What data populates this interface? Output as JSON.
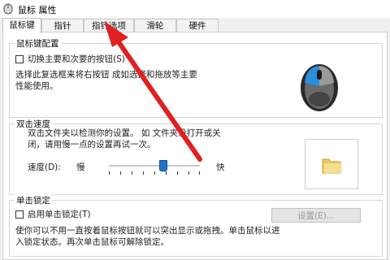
{
  "window": {
    "title": "鼠标 属性"
  },
  "tabs": [
    "鼠标键",
    "指针",
    "指针选项",
    "滑轮",
    "硬件"
  ],
  "button_config": {
    "group_title": "鼠标键配置",
    "checkbox_label": "切换主要和次要的按钮(S)",
    "desc_line1": "选择此复选框来将右按钮 成如选择和拖放等主要",
    "desc_line2": "性能使用。"
  },
  "double_click": {
    "group_title": "双击速度",
    "desc_line1": "双击文件夹以检测你的设置。 如 文件夹没打开或关",
    "desc_line2": "闭，请用慢一点的设置再试一次。",
    "speed_label": "速度(D):",
    "slow_label": "慢",
    "fast_label": "快",
    "slider_level": 0.6
  },
  "click_lock": {
    "group_title": "单击锁定",
    "checkbox_label": "启用单击锁定(T)",
    "settings_label": "设置(E)...",
    "desc_line1": "使你可以不用一直按着鼠标按钮就可以突出显示或拖拽。单击鼠标以进",
    "desc_line2": "入锁定状态。再次单击鼠标可解除锁定。"
  },
  "colors": {
    "accent_blue": "#1e73c8",
    "arrow_red": "#e02020",
    "folder_yellow": "#f1d77a"
  }
}
